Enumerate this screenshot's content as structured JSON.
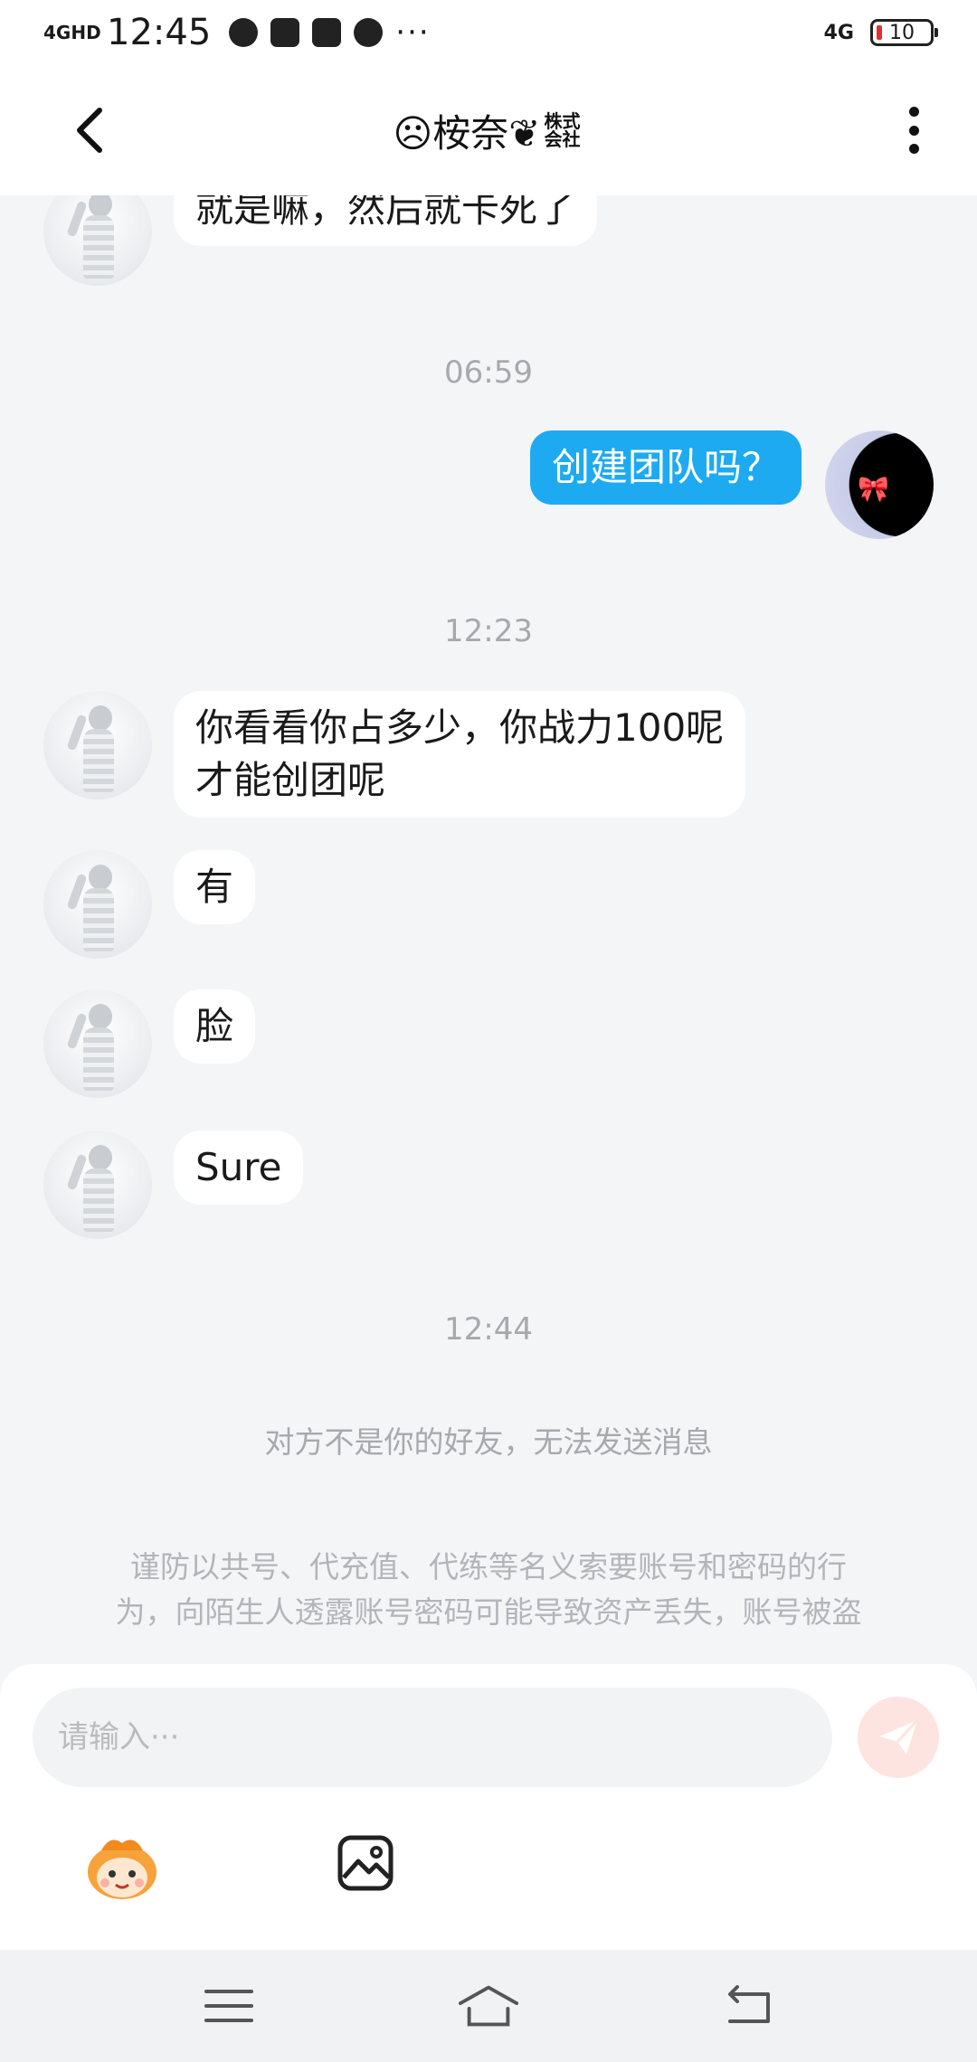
{
  "status_bar": {
    "network": "4GHD",
    "time": "12:45",
    "more": "···",
    "network_right": "4G",
    "battery": "10"
  },
  "header": {
    "title_main": "☹桉奈❦",
    "title_sub": "株式会社"
  },
  "messages": [
    {
      "side": "left",
      "text": "就是嘛，然后就卡死了"
    },
    {
      "type": "time",
      "text": "06:59"
    },
    {
      "side": "right",
      "text": "创建团队吗？"
    },
    {
      "type": "time",
      "text": "12:23"
    },
    {
      "side": "left",
      "text_line1": "你看看你占多少，你战力100呢",
      "text_line2": "才能创团呢"
    },
    {
      "side": "left",
      "text": "有"
    },
    {
      "side": "left",
      "text": "脸"
    },
    {
      "side": "left",
      "text": "Sure"
    },
    {
      "type": "time",
      "text": "12:44"
    }
  ],
  "notice": "对方不是你的好友，无法发送消息",
  "warning": {
    "line1": "谨防以共号、代充值、代练等名义索要账号和密码的行",
    "line2": "为，向陌生人透露账号密码可能导致资产丢失，账号被盗"
  },
  "input": {
    "placeholder": "请输入···"
  },
  "colors": {
    "accent_bubble": "#1eaaf1",
    "background": "#f4f5f7",
    "send_button": "#fde4e0"
  },
  "icons": [
    "back-arrow-icon",
    "more-vertical-icon",
    "send-icon",
    "emoji-icon",
    "image-icon",
    "menu-icon",
    "home-icon",
    "back-icon"
  ]
}
